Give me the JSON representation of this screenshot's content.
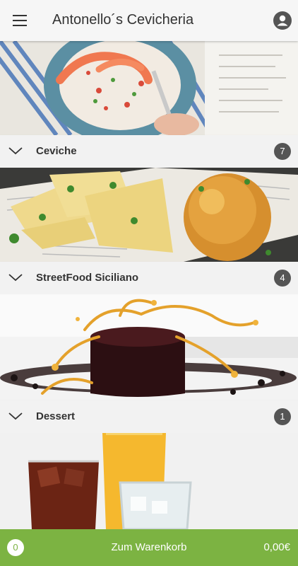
{
  "header": {
    "title": "Antonello´s Cevicheria",
    "menu_icon": "hamburger-menu-icon",
    "account_icon": "user-account-icon"
  },
  "categories": [
    {
      "name": "Ceviche",
      "count": "7"
    },
    {
      "name": "StreetFood Siciliano",
      "count": "4"
    },
    {
      "name": "Dessert",
      "count": "1"
    }
  ],
  "cart": {
    "count": "0",
    "label": "Zum Warenkorb",
    "total": "0,00€"
  },
  "colors": {
    "accent": "#7cb342",
    "badge": "#555555"
  }
}
